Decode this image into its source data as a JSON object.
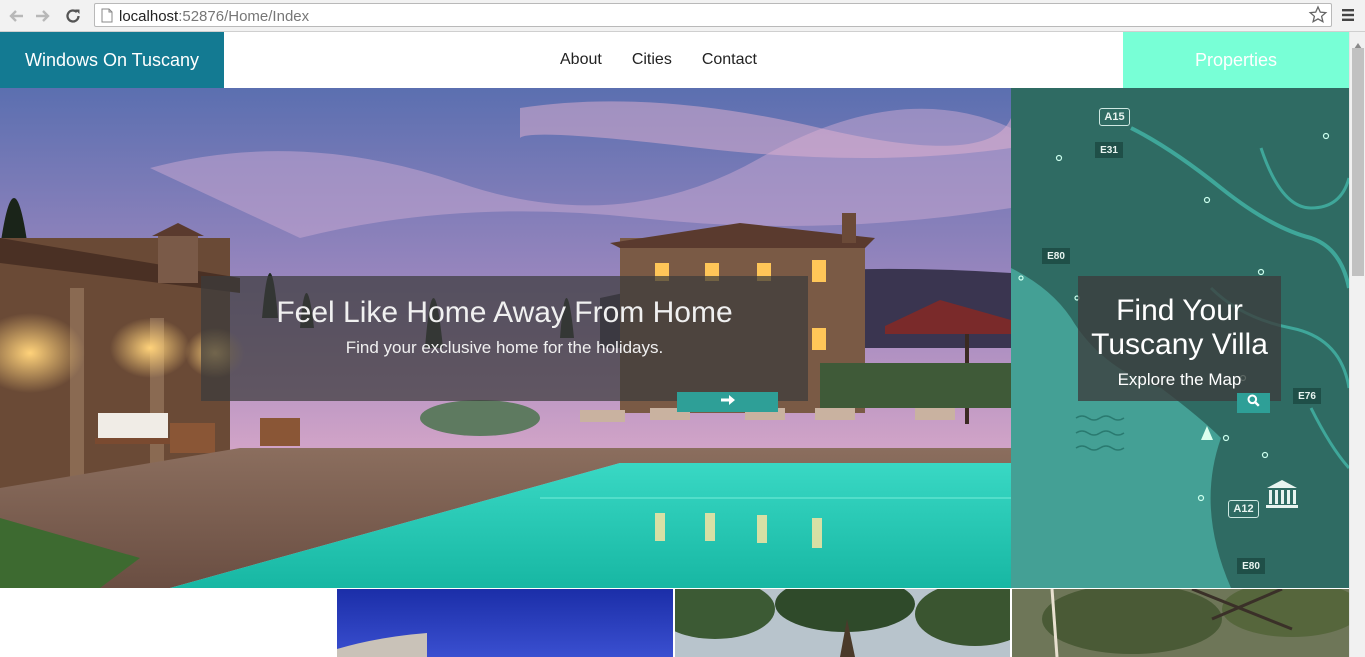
{
  "browser": {
    "url_host": "localhost",
    "url_path": ":52876/Home/Index",
    "icons": [
      "back-icon",
      "forward-icon",
      "reload-icon",
      "page-icon",
      "star-icon",
      "menu-icon"
    ]
  },
  "nav": {
    "brand": "Windows On Tuscany",
    "links": [
      "About",
      "Cities",
      "Contact"
    ],
    "properties": "Properties"
  },
  "hero": {
    "title": "Feel Like Home Away From Home",
    "subtitle": "Find your exclusive home for the holidays.",
    "button_icon": "arrow-right-icon"
  },
  "map": {
    "title_line1": "Find Your",
    "title_line2": "Tuscany Villa",
    "subtitle": "Explore the Map",
    "button_icon": "search-icon",
    "road_labels": [
      "A15",
      "E31",
      "E80",
      "E76",
      "A12",
      "E80"
    ]
  },
  "colors": {
    "brand_bg": "#137a92",
    "properties_bg": "#78ffd6",
    "accent_button": "#2e9f97",
    "map_bg": "#2f6b63"
  }
}
